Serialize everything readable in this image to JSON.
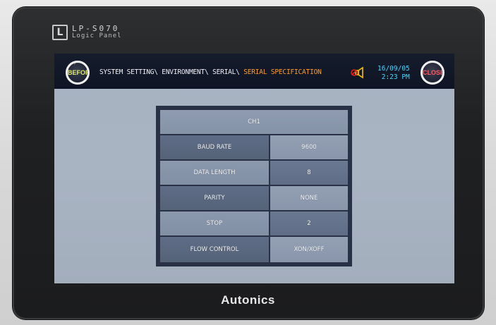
{
  "device": {
    "logo_letter": "L",
    "model": "LP-S070",
    "subtitle": "Logic Panel",
    "manufacturer": "Autonics"
  },
  "topbar": {
    "before_label": "BEFORE",
    "close_label": "CLOSE",
    "breadcrumb_path": "SYSTEM SETTING\\ ENVIRONMENT\\ SERIAL\\ ",
    "breadcrumb_current": "SERIAL SPECIFICATION",
    "date": "16/09/05",
    "time": "2:23 PM",
    "speaker_icon": "speaker-muted-icon"
  },
  "table": {
    "channel": "CH1",
    "rows": [
      {
        "label": "BAUD RATE",
        "value": "9600"
      },
      {
        "label": "DATA LENGTH",
        "value": "8"
      },
      {
        "label": "PARITY",
        "value": "NONE"
      },
      {
        "label": "STOP",
        "value": "2"
      },
      {
        "label": "FLOW CONTROL",
        "value": "XON/XOFF"
      }
    ]
  },
  "colors": {
    "breadcrumb_current": "#ff9d2a",
    "datetime": "#48d7ff",
    "before_text": "#e3f05a",
    "close_text": "#ff5a6a",
    "screen_bg": "#a7b2c1",
    "topbar_bg": "#151c2c"
  }
}
